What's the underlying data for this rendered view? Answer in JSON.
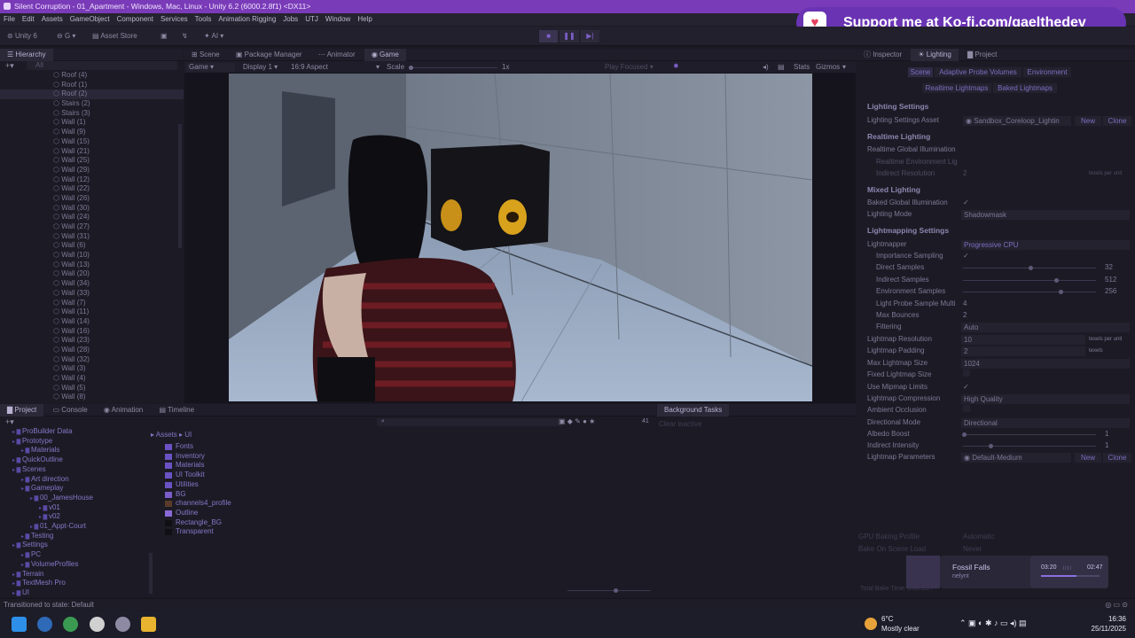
{
  "window": {
    "title": "Silent Corruption - 01_Apartment - Windows, Mac, Linux - Unity 6.2 (6000.2.8f1) <DX11>"
  },
  "menu": [
    "File",
    "Edit",
    "Assets",
    "GameObject",
    "Component",
    "Services",
    "Tools",
    "Animation Rigging",
    "Jobs",
    "UTJ",
    "Window",
    "Help"
  ],
  "kofi": {
    "text": "Support me at Ko-fi.com/gaelthedev",
    "cup_icon": "kofi-cup-icon",
    "color": "#6a33b3"
  },
  "toolbar": {
    "account": "Unity 6",
    "g": "G",
    "asset_store": "Asset Store",
    "ai": "AI"
  },
  "hierarchy": {
    "tab": "Hierarchy",
    "search_placeholder": "All",
    "items": [
      "Roof (4)",
      "Roof (1)",
      "Roof (2)",
      "Stairs (2)",
      "Stairs (3)",
      "Wall (1)",
      "Wall (9)",
      "Wall (15)",
      "Wall (21)",
      "Wall (25)",
      "Wall (29)",
      "Wall (12)",
      "Wall (22)",
      "Wall (26)",
      "Wall (30)",
      "Wall (24)",
      "Wall (27)",
      "Wall (31)",
      "Wall (6)",
      "Wall (10)",
      "Wall (13)",
      "Wall (20)",
      "Wall (34)",
      "Wall (33)",
      "Wall (7)",
      "Wall (11)",
      "Wall (14)",
      "Wall (16)",
      "Wall (23)",
      "Wall (28)",
      "Wall (32)",
      "Wall (3)",
      "Wall (4)",
      "Wall (5)",
      "Wall (8)"
    ]
  },
  "center_tabs": [
    "Scene",
    "Package Manager",
    "Animator",
    "Game"
  ],
  "game_bar": {
    "mode": "Game",
    "display": "Display 1",
    "aspect": "16:9 Aspect",
    "scale_label": "Scale",
    "scale_value": "1x",
    "play_focused": "Play Focused",
    "stats": "Stats",
    "gizmos": "Gizmos"
  },
  "right_tabs": [
    "Inspector",
    "Lighting",
    "Project"
  ],
  "lighting": {
    "subtabs": [
      "Scene",
      "Adaptive Probe Volumes",
      "Environment"
    ],
    "subtabs2": [
      "Realtime Lightmaps",
      "Baked Lightmaps"
    ],
    "settings_header": "Lighting Settings",
    "settings_asset_label": "Lighting Settings Asset",
    "settings_asset_value": "Sandbox_Coreloop_Lightin",
    "new": "New",
    "clone": "Clone",
    "realtime_header": "Realtime Lighting",
    "realtime_gi": "Realtime Global Illumination",
    "realtime_env": "Realtime Environment Lig",
    "indirect_res": "Indirect Resolution",
    "indirect_res_value": "2",
    "texels": "texels per unit",
    "mixed_header": "Mixed Lighting",
    "baked_gi": "Baked Global Illumination",
    "lighting_mode": "Lighting Mode",
    "lighting_mode_value": "Shadowmask",
    "lightmapping_header": "Lightmapping Settings",
    "lightmapper": "Lightmapper",
    "lightmapper_value": "Progressive CPU",
    "importance_sampling": "Importance Sampling",
    "direct_samples": "Direct Samples",
    "direct_samples_value": "32",
    "indirect_samples": "Indirect Samples",
    "indirect_samples_value": "512",
    "env_samples": "Environment Samples",
    "env_samples_value": "256",
    "light_probe_mult": "Light Probe Sample Multi",
    "light_probe_mult_value": "4",
    "max_bounces": "Max Bounces",
    "max_bounces_value": "2",
    "filtering": "Filtering",
    "filtering_value": "Auto",
    "lightmap_resolution": "Lightmap Resolution",
    "lightmap_resolution_value": "10",
    "texels_unit": "texels per unit",
    "lightmap_padding": "Lightmap Padding",
    "lightmap_padding_value": "2",
    "texels2": "texels",
    "max_lightmap_size": "Max Lightmap Size",
    "max_lightmap_size_value": "1024",
    "fixed_lightmap_size": "Fixed Lightmap Size",
    "use_mipmap_limits": "Use Mipmap Limits",
    "lightmap_compression": "Lightmap Compression",
    "lightmap_compression_value": "High Quality",
    "ambient_occlusion": "Ambient Occlusion",
    "directional_mode": "Directional Mode",
    "directional_mode_value": "Directional",
    "albedo_boost": "Albedo Boost",
    "albedo_boost_value": "1",
    "indirect_intensity": "Indirect Intensity",
    "indirect_intensity_value": "1",
    "lightmap_params": "Lightmap Parameters",
    "lightmap_params_value": "Default-Medium",
    "gpu_baking_profile": "GPU Baking Profile",
    "gpu_baking_profile_value": "Automatic",
    "bake_on_scene_load": "Bake On Scene Load",
    "bake_on_scene_load_value": "Never",
    "total_bake_time": "Total Bake Time: 0:00:03:7"
  },
  "media": {
    "title": "Fossil Falls",
    "artist": "nelynt",
    "elapsed": "03:20",
    "total": "02:47",
    "progress": 0.6
  },
  "bottom_tabs": [
    "Project",
    "Console",
    "Animation",
    "Timeline"
  ],
  "project": {
    "count": "41",
    "breadcrumb": [
      "Assets",
      "UI"
    ],
    "tree": [
      "ProBuilder Data",
      "Prototype",
      "Materials",
      "QuickOutline",
      "Scenes",
      "Art direction",
      "Gameplay",
      "00_JamesHouse",
      "v01",
      "v02",
      "01_Appt-Court",
      "Testing",
      "Settings",
      "PC",
      "VolumeProfiles",
      "Terrain",
      "TextMesh Pro",
      "UI"
    ],
    "assets": [
      "Fonts",
      "Inventory",
      "Materials",
      "UI Toolkit",
      "Utilities",
      "BG",
      "channels4_profile",
      "Outline",
      "Rectangle_BG",
      "Transparent"
    ]
  },
  "bgtasks": {
    "title": "Background Tasks",
    "clear": "Clear inactive"
  },
  "status": {
    "text": "Transitioned to state: Default"
  },
  "tray": {
    "temp": "6°C",
    "weather": "Mostly clear",
    "time": "16:36",
    "date": "25/11/2025"
  }
}
